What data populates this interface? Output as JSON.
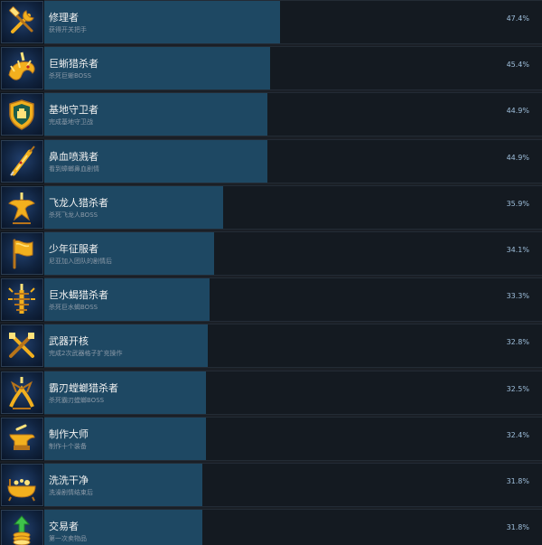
{
  "achievements": [
    {
      "title": "修理者",
      "description": "获得开关把手",
      "percent_text": "47.4%",
      "percent": 47.4,
      "icon": "wrench-hammer-icon"
    },
    {
      "title": "巨蜥猎杀者",
      "description": "杀死巨蜥BOSS",
      "percent_text": "45.4%",
      "percent": 45.4,
      "icon": "lizard-boss-icon"
    },
    {
      "title": "基地守卫者",
      "description": "完成基地守卫战",
      "percent_text": "44.9%",
      "percent": 44.9,
      "icon": "shield-icon"
    },
    {
      "title": "鼻血喷溅者",
      "description": "看到蟑螂鼻血剧情",
      "percent_text": "44.9%",
      "percent": 44.9,
      "icon": "syringe-icon"
    },
    {
      "title": "飞龙人猎杀者",
      "description": "杀死飞龙人BOSS",
      "percent_text": "35.9%",
      "percent": 35.9,
      "icon": "dragon-boss-icon"
    },
    {
      "title": "少年征服者",
      "description": "尼亚加入团队的剧情后",
      "percent_text": "34.1%",
      "percent": 34.1,
      "icon": "flag-icon"
    },
    {
      "title": "巨水蝎猎杀者",
      "description": "杀死巨水蝎BOSS",
      "percent_text": "33.3%",
      "percent": 33.3,
      "icon": "scorpion-boss-icon"
    },
    {
      "title": "武器开核",
      "description": "完成2次武器格子扩充操作",
      "percent_text": "32.8%",
      "percent": 32.8,
      "icon": "crossed-weapons-icon"
    },
    {
      "title": "霸刃螳螂猎杀者",
      "description": "杀死霸刃螳螂BOSS",
      "percent_text": "32.5%",
      "percent": 32.5,
      "icon": "mantis-boss-icon"
    },
    {
      "title": "制作大师",
      "description": "制作十个装备",
      "percent_text": "32.4%",
      "percent": 32.4,
      "icon": "anvil-icon"
    },
    {
      "title": "洗洗干净",
      "description": "洗澡剧情结束后",
      "percent_text": "31.8%",
      "percent": 31.8,
      "icon": "bathtub-icon"
    },
    {
      "title": "交易者",
      "description": "第一次卖物品",
      "percent_text": "31.8%",
      "percent": 31.8,
      "icon": "coins-arrow-icon"
    }
  ],
  "colors": {
    "bar": "#1e4863",
    "row_background": "#141a21",
    "icon_gold": "#f2b01e",
    "percent_text": "#9fbfdc"
  }
}
